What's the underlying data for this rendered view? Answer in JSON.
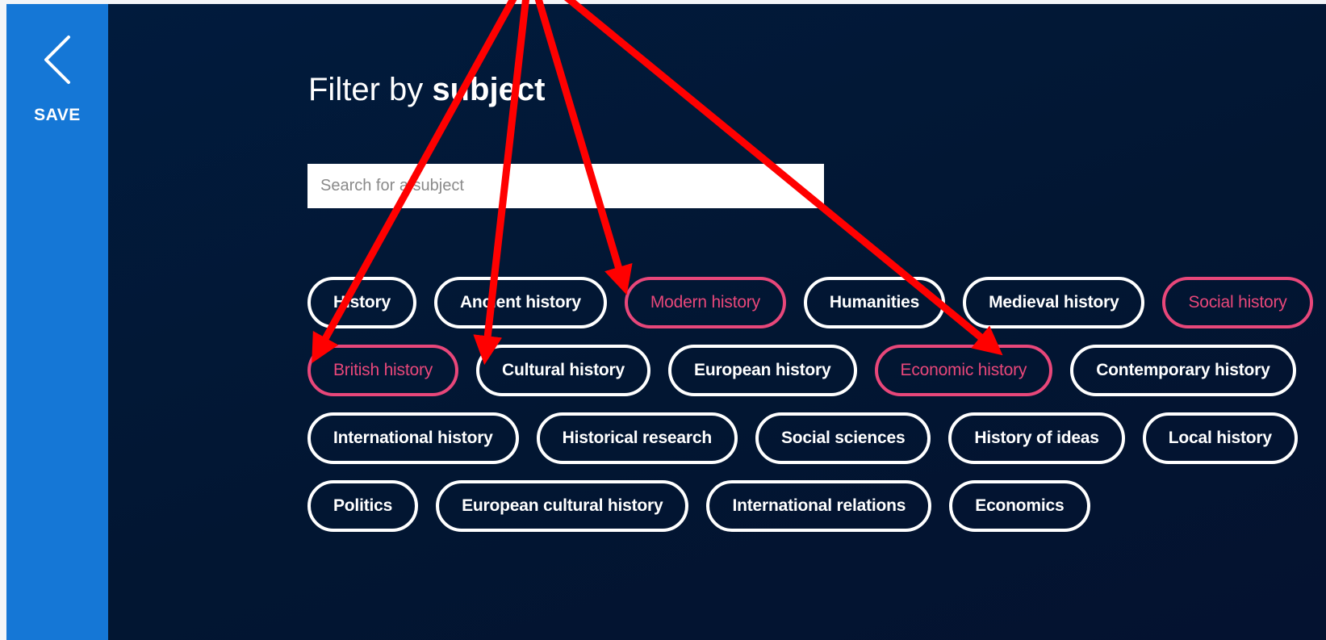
{
  "sidebar": {
    "back_icon": "chevron-left-icon",
    "save_label": "SAVE",
    "background": "#1577d6"
  },
  "main": {
    "title_prefix": "Filter by",
    "title_emphasis": "subject",
    "background": "#011b3d"
  },
  "search": {
    "placeholder": "Search for a subject",
    "value": ""
  },
  "chips": [
    {
      "label": "History",
      "selected": false
    },
    {
      "label": "Ancient history",
      "selected": false
    },
    {
      "label": "Modern history",
      "selected": true
    },
    {
      "label": "Humanities",
      "selected": false
    },
    {
      "label": "Medieval history",
      "selected": false
    },
    {
      "label": "Social history",
      "selected": true
    },
    {
      "label": "British history",
      "selected": true
    },
    {
      "label": "Cultural history",
      "selected": false
    },
    {
      "label": "European history",
      "selected": false
    },
    {
      "label": "Economic history",
      "selected": true
    },
    {
      "label": "Contemporary history",
      "selected": false
    },
    {
      "label": "International history",
      "selected": false
    },
    {
      "label": "Historical research",
      "selected": false
    },
    {
      "label": "Social sciences",
      "selected": false
    },
    {
      "label": "History of ideas",
      "selected": false
    },
    {
      "label": "Local history",
      "selected": false
    },
    {
      "label": "Politics",
      "selected": false
    },
    {
      "label": "European cultural history",
      "selected": false
    },
    {
      "label": "International relations",
      "selected": false
    },
    {
      "label": "Economics",
      "selected": false
    }
  ],
  "colors": {
    "selected_chip": "#e8477a",
    "chip_border": "#ffffff",
    "annotation_arrow": "#ff0000"
  },
  "annotation": {
    "type": "red-arrows",
    "targets": [
      "Social history",
      "British history",
      "Modern history",
      "Economic history"
    ]
  }
}
